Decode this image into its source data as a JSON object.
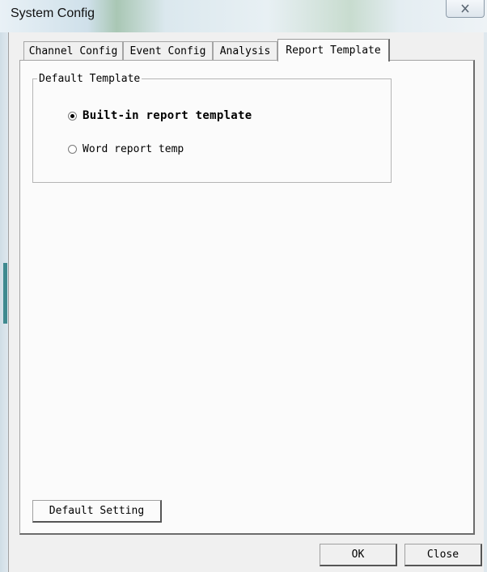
{
  "window": {
    "title": "System Config",
    "close_icon": "close-icon"
  },
  "tabs": [
    {
      "label": "Channel Config",
      "active": false
    },
    {
      "label": "Event Config",
      "active": false
    },
    {
      "label": "Analysis",
      "active": false
    },
    {
      "label": "Report Template",
      "active": true
    }
  ],
  "default_template": {
    "title": "Default Template",
    "options": [
      {
        "label": "Built-in report template",
        "checked": true
      },
      {
        "label": "Word report temp",
        "checked": false
      }
    ]
  },
  "buttons": {
    "default_setting": "Default Setting",
    "ok": "OK",
    "close": "Close"
  }
}
